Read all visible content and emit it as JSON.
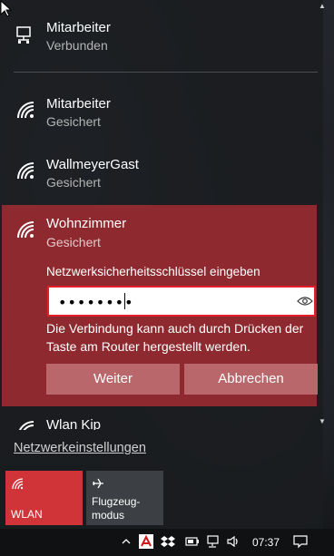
{
  "networks": [
    {
      "name": "Mitarbeiter",
      "status": "Verbunden"
    },
    {
      "name": "Mitarbeiter",
      "status": "Gesichert"
    },
    {
      "name": "WallmeyerGast",
      "status": "Gesichert"
    }
  ],
  "expanded": {
    "name": "Wohnzimmer",
    "status": "Gesichert",
    "key_label": "Netzwerksicherheitsschlüssel eingeben",
    "key_value": "••••••••",
    "hint": "Die Verbindung kann auch durch Drücken der Taste am Router hergestellt werden.",
    "next_label": "Weiter",
    "cancel_label": "Abbrechen"
  },
  "partial_network": {
    "name": "Wlan Kip"
  },
  "settings_link": "Netzwerkeinstellungen",
  "quick_actions": {
    "wlan": "WLAN",
    "flight_line1": "Flugzeug-",
    "flight_line2": "modus"
  },
  "taskbar": {
    "time": "07:37"
  },
  "colors": {
    "accent": "#d13438",
    "expanded_bg": "#8e2a2f",
    "button_bg": "#b9676b",
    "input_border": "#e01f2a"
  },
  "icons": [
    "ethernet-icon",
    "wifi-icon",
    "eye-icon",
    "airplane-icon",
    "chevron-up-icon",
    "chevron-down-icon",
    "notification-icon"
  ]
}
